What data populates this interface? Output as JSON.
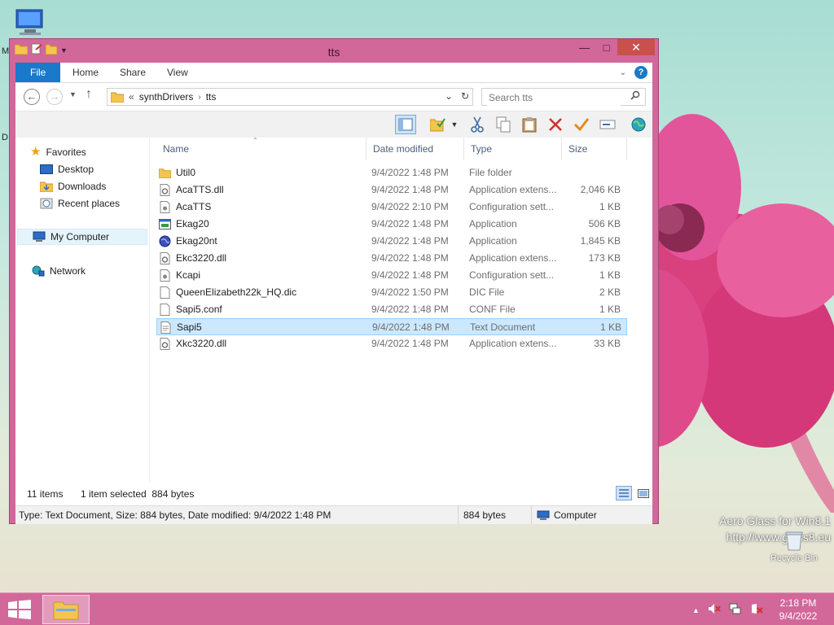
{
  "window": {
    "title": "tts"
  },
  "ribbon": {
    "tabs": [
      "File",
      "Home",
      "Share",
      "View"
    ]
  },
  "address": {
    "crumbs": [
      "synthDrivers",
      "tts"
    ],
    "overflow": "«"
  },
  "search": {
    "placeholder": "Search tts"
  },
  "navpane": {
    "favorites": "Favorites",
    "items": [
      "Desktop",
      "Downloads",
      "Recent places"
    ],
    "computer": "My Computer",
    "network": "Network"
  },
  "columns": {
    "name": "Name",
    "date": "Date modified",
    "type": "Type",
    "size": "Size"
  },
  "files": [
    {
      "name": "Util0",
      "date": "9/4/2022 1:48 PM",
      "type": "File folder",
      "size": "",
      "icon": "folder-icon"
    },
    {
      "name": "AcaTTS.dll",
      "date": "9/4/2022 1:48 PM",
      "type": "Application extens...",
      "size": "2,046 KB",
      "icon": "dll-file-icon"
    },
    {
      "name": "AcaTTS",
      "date": "9/4/2022 2:10 PM",
      "type": "Configuration sett...",
      "size": "1 KB",
      "icon": "config-file-icon"
    },
    {
      "name": "Ekag20",
      "date": "9/4/2022 1:48 PM",
      "type": "Application",
      "size": "506 KB",
      "icon": "application-icon"
    },
    {
      "name": "Ekag20nt",
      "date": "9/4/2022 1:48 PM",
      "type": "Application",
      "size": "1,845 KB",
      "icon": "application-globe-icon"
    },
    {
      "name": "Ekc3220.dll",
      "date": "9/4/2022 1:48 PM",
      "type": "Application extens...",
      "size": "173 KB",
      "icon": "dll-file-icon"
    },
    {
      "name": "Kcapi",
      "date": "9/4/2022 1:48 PM",
      "type": "Configuration sett...",
      "size": "1 KB",
      "icon": "config-file-icon"
    },
    {
      "name": "QueenElizabeth22k_HQ.dic",
      "date": "9/4/2022 1:50 PM",
      "type": "DIC File",
      "size": "2 KB",
      "icon": "generic-file-icon"
    },
    {
      "name": "Sapi5.conf",
      "date": "9/4/2022 1:48 PM",
      "type": "CONF File",
      "size": "1 KB",
      "icon": "generic-file-icon"
    },
    {
      "name": "Sapi5",
      "date": "9/4/2022 1:48 PM",
      "type": "Text Document",
      "size": "1 KB",
      "icon": "text-file-icon",
      "selected": true
    },
    {
      "name": "Xkc3220.dll",
      "date": "9/4/2022 1:48 PM",
      "type": "Application extens...",
      "size": "33 KB",
      "icon": "dll-file-icon"
    }
  ],
  "status": {
    "count": "11 items",
    "selection": "1 item selected  884 bytes"
  },
  "details": {
    "info": "Type: Text Document, Size: 884 bytes, Date modified: 9/4/2022 1:48 PM",
    "size": "884 bytes",
    "location": "Computer"
  },
  "desktop": {
    "watermark_line1": "Aero Glass for Win8.1",
    "watermark_line2": "http://www.glass8.eu",
    "recycle_bin": "Recycle Bin",
    "edge_label_1": "M",
    "edge_label_2": "D"
  },
  "taskbar": {
    "time": "2:18 PM",
    "date": "9/4/2022"
  },
  "colors": {
    "frame": "#d2679a",
    "accent": "#1979ca",
    "selection": "#cce8ff",
    "close": "#c9504b"
  }
}
